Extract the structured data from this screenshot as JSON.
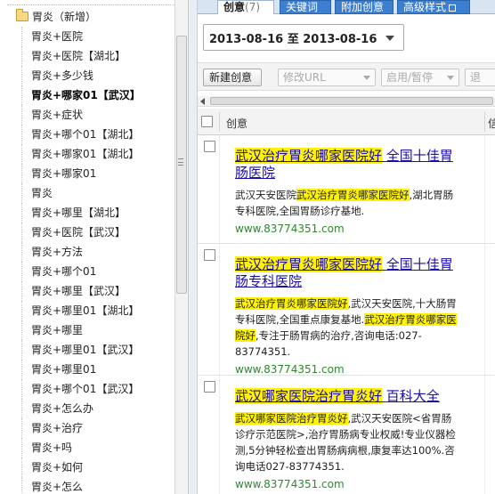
{
  "tree": {
    "folder_label": "胃炎（新增）",
    "items": [
      "胃炎+医院",
      "胃炎+医院【湖北】",
      "胃炎+多少钱",
      "胃炎+哪家01【武汉】",
      "胃炎+症状",
      "胃炎+哪个01【湖北】",
      "胃炎+哪家01【湖北】",
      "胃炎+哪家01",
      "胃炎",
      "胃炎+哪里【湖北】",
      "胃炎+医院【武汉】",
      "胃炎+方法",
      "胃炎+哪个01",
      "胃炎+哪里【武汉】",
      "胃炎+哪里01【湖北】",
      "胃炎+哪里",
      "胃炎+哪里01【武汉】",
      "胃炎+哪里01",
      "胃炎+哪个01【武汉】",
      "胃炎+怎么办",
      "胃炎+治疗",
      "胃炎+吗",
      "胃炎+如何",
      "胃炎+怎么"
    ],
    "selected_index": 3
  },
  "tabs": {
    "creative_label": "创意",
    "creative_count": "(7)",
    "keyword_label": "关键词",
    "addon_label": "附加创意",
    "advanced_label": "高级样式"
  },
  "date_range": {
    "start": "2013-08-16",
    "to": "至",
    "end": "2013-08-16"
  },
  "toolbar": {
    "new_creative": "新建创意",
    "modify_url": "修改URL",
    "enable_pause": "启用/暂停",
    "more": "退"
  },
  "grid": {
    "column_creative": "创意",
    "column_right": "信"
  },
  "ads": [
    {
      "title_hl": "武汉治疗胃炎哪家医院好",
      "title_rest": "全国十佳胃肠医院",
      "desc_pre": "武汉天安医院",
      "desc_hl": "武汉治疗胃炎哪家医院好",
      "desc_post": ",湖北胃肠专科医院,全国胃肠诊疗基地.",
      "url": "www.83774351.com"
    },
    {
      "title_hl": "武汉治疗胃炎哪家医院好",
      "title_rest": "全国十佳胃肠专科医院",
      "desc_hl1": "武汉治疗胃炎哪家医院好",
      "desc_mid": ",武汉天安医院,十大肠胃专科医院,全国重点康复基地.",
      "desc_hl2": "武汉治疗胃炎哪家医院好",
      "desc_post": ",专注于肠胃病的治疗,咨询电话:027-83774351.",
      "url": "www.83774351.com"
    },
    {
      "title_hl": "武汉哪家医院治疗胃炎好",
      "title_rest": "百科大全",
      "desc_hl": "武汉哪家医院治疗胃炎好",
      "desc_post": ",武汉天安医院<省胃肠诊疗示范医院>,治疗胃肠病专业权威!专业仪器检测,5分钟轻松查出胃肠病病根,康复率达100%.咨询电话027-83774351.",
      "url": "www.83774351.com"
    }
  ],
  "colors": {
    "link": "#1a0dab",
    "highlight": "#fff200",
    "url_green": "#2b8a2b",
    "tab_blue": "#3c7fd0"
  }
}
